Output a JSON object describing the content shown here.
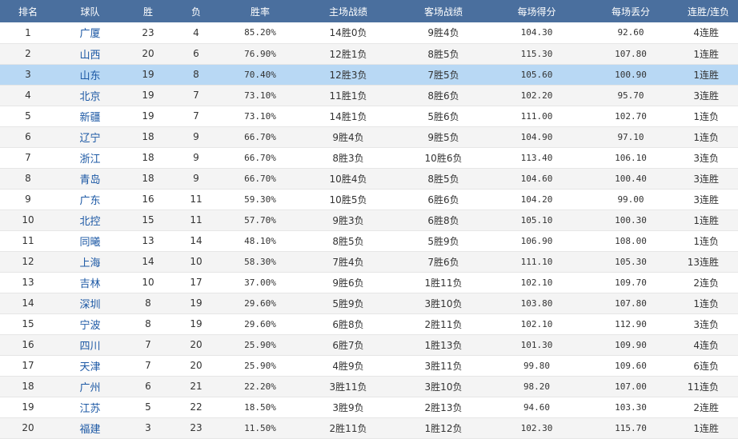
{
  "columns": [
    "排名",
    "球队",
    "胜",
    "负",
    "胜率",
    "主场战绩",
    "客场战绩",
    "每场得分",
    "每场丢分",
    "连胜/连负"
  ],
  "selected_row": 3,
  "rows": [
    [
      "1",
      "广厦",
      "23",
      "4",
      "85.20%",
      "14胜0负",
      "9胜4负",
      "104.30",
      "92.60",
      "4连胜"
    ],
    [
      "2",
      "山西",
      "20",
      "6",
      "76.90%",
      "12胜1负",
      "8胜5负",
      "115.30",
      "107.80",
      "1连胜"
    ],
    [
      "3",
      "山东",
      "19",
      "8",
      "70.40%",
      "12胜3负",
      "7胜5负",
      "105.60",
      "100.90",
      "1连胜"
    ],
    [
      "4",
      "北京",
      "19",
      "7",
      "73.10%",
      "11胜1负",
      "8胜6负",
      "102.20",
      "95.70",
      "3连胜"
    ],
    [
      "5",
      "新疆",
      "19",
      "7",
      "73.10%",
      "14胜1负",
      "5胜6负",
      "111.00",
      "102.70",
      "1连负"
    ],
    [
      "6",
      "辽宁",
      "18",
      "9",
      "66.70%",
      "9胜4负",
      "9胜5负",
      "104.90",
      "97.10",
      "1连负"
    ],
    [
      "7",
      "浙江",
      "18",
      "9",
      "66.70%",
      "8胜3负",
      "10胜6负",
      "113.40",
      "106.10",
      "3连负"
    ],
    [
      "8",
      "青岛",
      "18",
      "9",
      "66.70%",
      "10胜4负",
      "8胜5负",
      "104.60",
      "100.40",
      "3连胜"
    ],
    [
      "9",
      "广东",
      "16",
      "11",
      "59.30%",
      "10胜5负",
      "6胜6负",
      "104.20",
      "99.00",
      "3连胜"
    ],
    [
      "10",
      "北控",
      "15",
      "11",
      "57.70%",
      "9胜3负",
      "6胜8负",
      "105.10",
      "100.30",
      "1连胜"
    ],
    [
      "11",
      "同曦",
      "13",
      "14",
      "48.10%",
      "8胜5负",
      "5胜9负",
      "106.90",
      "108.00",
      "1连负"
    ],
    [
      "12",
      "上海",
      "14",
      "10",
      "58.30%",
      "7胜4负",
      "7胜6负",
      "111.10",
      "105.30",
      "13连胜"
    ],
    [
      "13",
      "吉林",
      "10",
      "17",
      "37.00%",
      "9胜6负",
      "1胜11负",
      "102.10",
      "109.70",
      "2连负"
    ],
    [
      "14",
      "深圳",
      "8",
      "19",
      "29.60%",
      "5胜9负",
      "3胜10负",
      "103.80",
      "107.80",
      "1连负"
    ],
    [
      "15",
      "宁波",
      "8",
      "19",
      "29.60%",
      "6胜8负",
      "2胜11负",
      "102.10",
      "112.90",
      "3连负"
    ],
    [
      "16",
      "四川",
      "7",
      "20",
      "25.90%",
      "6胜7负",
      "1胜13负",
      "101.30",
      "109.90",
      "4连负"
    ],
    [
      "17",
      "天津",
      "7",
      "20",
      "25.90%",
      "4胜9负",
      "3胜11负",
      "99.80",
      "109.60",
      "6连负"
    ],
    [
      "18",
      "广州",
      "6",
      "21",
      "22.20%",
      "3胜11负",
      "3胜10负",
      "98.20",
      "107.00",
      "11连负"
    ],
    [
      "19",
      "江苏",
      "5",
      "22",
      "18.50%",
      "3胜9负",
      "2胜13负",
      "94.60",
      "103.30",
      "2连胜"
    ],
    [
      "20",
      "福建",
      "3",
      "23",
      "11.50%",
      "2胜11负",
      "1胜12负",
      "102.30",
      "115.70",
      "1连胜"
    ]
  ]
}
